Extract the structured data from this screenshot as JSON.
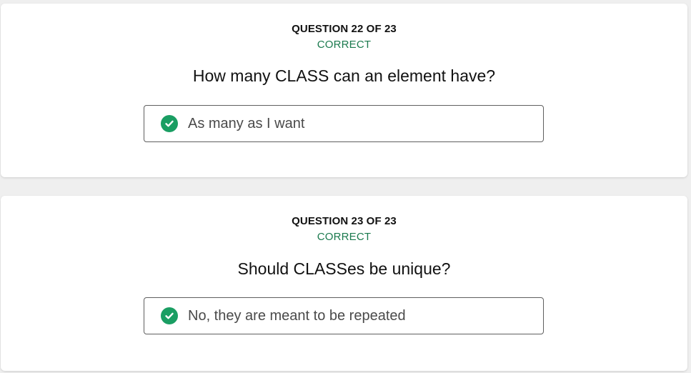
{
  "questions": [
    {
      "counter": "QUESTION 22 OF 23",
      "status": "CORRECT",
      "question": "How many CLASS can an element have?",
      "answer": "As many as I want",
      "answer_icon": "check-circle-icon"
    },
    {
      "counter": "QUESTION 23 OF 23",
      "status": "CORRECT",
      "question": "Should CLASSes be unique?",
      "answer": "No, they are meant to be repeated",
      "answer_icon": "check-circle-icon"
    }
  ],
  "colors": {
    "correct_text": "#1b7a4e",
    "check_badge": "#1a9e63",
    "page_background": "#efefef",
    "card_background": "#ffffff"
  }
}
